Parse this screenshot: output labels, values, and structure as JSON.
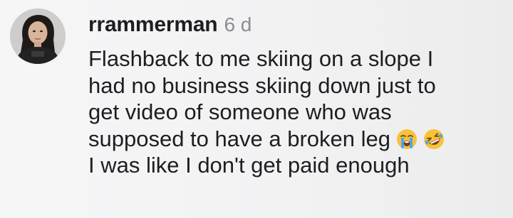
{
  "comment": {
    "username": "rrammerman",
    "time": "6 d",
    "lines": [
      "Flashback to me skiing on a slope I",
      "had no business skiing down just to",
      "get video of someone who was",
      "supposed to have a broken leg",
      "I was like I don't get paid enough"
    ],
    "emojis": [
      "loudly-crying-face-emoji",
      "rolling-on-floor-laughing-emoji"
    ]
  }
}
